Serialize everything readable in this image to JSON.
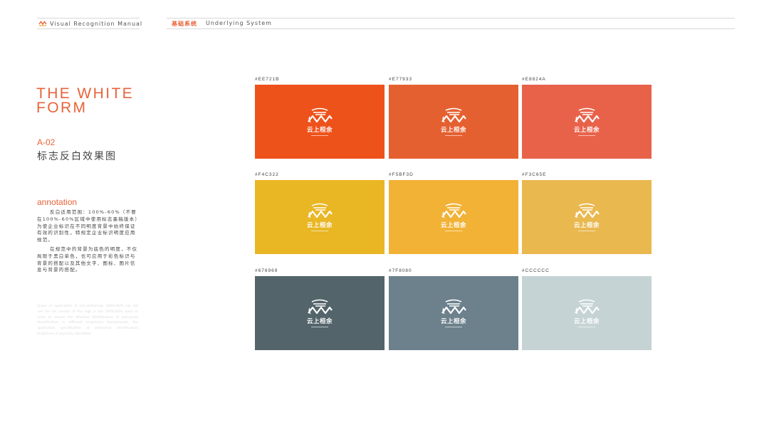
{
  "header": {
    "brand": "Visual Recognition Manual",
    "section_cn": "基础系统",
    "section_en": "Underlying System"
  },
  "page": {
    "title": "THE WHITE FORM",
    "code": "A-02",
    "subtitle": "标志反白效果图",
    "annotation_head": "annotation",
    "annotation_p1": "反白适用范围：100%-60%（不要在100%-60%区域中使用标志墨稿版本）为使企业标识在不同明度背景中始终保证有效的识别性，特规定企业标识明度应用规范。",
    "annotation_p2": "在规范中的背景为底色的明度，不仅局限于黑白单色，也可应用于彩色标识与背景的搭配以及其他文字、图标、图片信息与背景的搭配。",
    "annotation_en": "Scope of application of anti-whitening: 100%-60% (do not use the ink version of the logo in the 100%-60% area) In order to ensure the effective identification of enterprise identification in different brightness backgrounds, the application specification of enterprise identification brightness is specially stipulated."
  },
  "swatches": [
    {
      "label": "#EE721B",
      "color": "#EE521B",
      "logo_text": "云上桓余"
    },
    {
      "label": "#E77933",
      "color": "#E56030",
      "logo_text": "云上桓余"
    },
    {
      "label": "#E8824A",
      "color": "#E8624A",
      "logo_text": "云上桓余"
    },
    {
      "label": "#F4C322",
      "color": "#E9B624",
      "logo_text": "云上桓余"
    },
    {
      "label": "#F5BF3D",
      "color": "#F2B236",
      "logo_text": "云上桓余"
    },
    {
      "label": "#F3C65E",
      "color": "#E9B84F",
      "logo_text": "云上桓余"
    },
    {
      "label": "#676969",
      "color": "#53646B",
      "logo_text": "云上桓余"
    },
    {
      "label": "#7F8080",
      "color": "#6C818C",
      "logo_text": "云上桓余"
    },
    {
      "label": "#CCCCCC",
      "color": "#C5D3D5",
      "logo_text": "云上桓余"
    }
  ]
}
